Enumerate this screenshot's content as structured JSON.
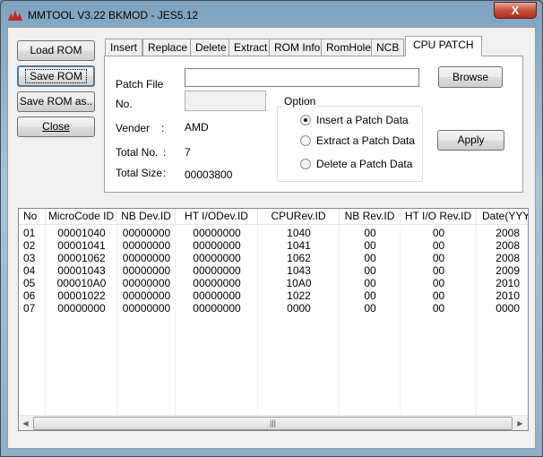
{
  "window": {
    "title": "MMTOOL V3.22 BKMOD - JES5.12",
    "close_label": "X"
  },
  "side_buttons": [
    {
      "label": "Load ROM"
    },
    {
      "label": "Save ROM"
    },
    {
      "label": "Save ROM as.."
    },
    {
      "label": "Close"
    }
  ],
  "tabs": [
    {
      "label": "Insert"
    },
    {
      "label": "Replace"
    },
    {
      "label": "Delete"
    },
    {
      "label": "Extract"
    },
    {
      "label": "ROM Info"
    },
    {
      "label": "RomHole"
    },
    {
      "label": "NCB"
    },
    {
      "label": "CPU PATCH",
      "selected": true
    }
  ],
  "patch": {
    "patch_file_label": "Patch File",
    "patch_file_value": "",
    "no_label": "No.",
    "no_value": "",
    "browse_label": "Browse",
    "apply_label": "Apply",
    "vender_label": "Vender",
    "vender_colon": ":",
    "vender_value": "AMD",
    "total_no_label": "Total No.",
    "total_no_colon": ":",
    "total_no_value": "7",
    "total_size_label": "Total Size",
    "total_size_colon": ":",
    "total_size_value": "00003800",
    "option_title": "Option",
    "options": [
      {
        "label": "Insert a Patch Data",
        "checked": true
      },
      {
        "label": "Extract a Patch Data",
        "checked": false
      },
      {
        "label": "Delete a Patch Data",
        "checked": false
      }
    ]
  },
  "table": {
    "columns": [
      "No",
      "MicroCode ID",
      "NB Dev.ID",
      "HT I/ODev.ID",
      "CPURev.ID",
      "NB Rev.ID",
      "HT I/O Rev.ID",
      "Date(YYY"
    ],
    "rows": [
      [
        "01",
        "00001040",
        "00000000",
        "00000000",
        "1040",
        "00",
        "00",
        "2008"
      ],
      [
        "02",
        "00001041",
        "00000000",
        "00000000",
        "1041",
        "00",
        "00",
        "2008"
      ],
      [
        "03",
        "00001062",
        "00000000",
        "00000000",
        "1062",
        "00",
        "00",
        "2008"
      ],
      [
        "04",
        "00001043",
        "00000000",
        "00000000",
        "1043",
        "00",
        "00",
        "2009"
      ],
      [
        "05",
        "000010A0",
        "00000000",
        "00000000",
        "10A0",
        "00",
        "00",
        "2010"
      ],
      [
        "06",
        "00001022",
        "00000000",
        "00000000",
        "1022",
        "00",
        "00",
        "2010"
      ],
      [
        "07",
        "00000000",
        "00000000",
        "00000000",
        "0000",
        "00",
        "00",
        "0000"
      ]
    ],
    "scroll_thumb_grip": "|||"
  }
}
